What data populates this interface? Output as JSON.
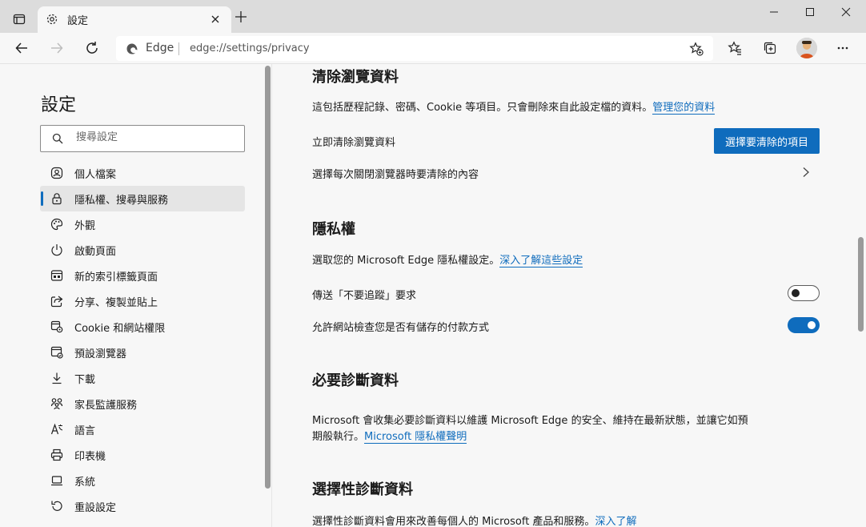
{
  "window": {
    "tab_title": "設定"
  },
  "toolbar": {
    "address_prefix": "Edge",
    "url": "edge://settings/privacy"
  },
  "sidebar": {
    "title": "設定",
    "search_placeholder": "搜尋設定",
    "items": [
      {
        "label": "個人檔案",
        "icon": "profile-icon"
      },
      {
        "label": "隱私權、搜尋與服務",
        "icon": "lock-icon",
        "active": true
      },
      {
        "label": "外觀",
        "icon": "palette-icon"
      },
      {
        "label": "啟動頁面",
        "icon": "power-icon"
      },
      {
        "label": "新的索引標籤頁面",
        "icon": "newtab-icon"
      },
      {
        "label": "分享、複製並貼上",
        "icon": "share-icon"
      },
      {
        "label": "Cookie 和網站權限",
        "icon": "site-permissions-icon"
      },
      {
        "label": "預設瀏覽器",
        "icon": "default-browser-icon"
      },
      {
        "label": "下載",
        "icon": "download-icon"
      },
      {
        "label": "家長監護服務",
        "icon": "family-icon"
      },
      {
        "label": "語言",
        "icon": "language-icon"
      },
      {
        "label": "印表機",
        "icon": "printer-icon"
      },
      {
        "label": "系統",
        "icon": "system-icon"
      },
      {
        "label": "重設設定",
        "icon": "reset-icon"
      }
    ]
  },
  "content": {
    "clear_data": {
      "heading": "清除瀏覽資料",
      "desc": "這包括歷程記錄、密碼、Cookie 等項目。只會刪除來自此設定檔的資料。",
      "desc_link": "管理您的資料",
      "clear_now_label": "立即清除瀏覽資料",
      "clear_button": "選擇要清除的項目",
      "on_close_label": "選擇每次關閉瀏覽器時要清除的內容"
    },
    "privacy": {
      "heading": "隱私權",
      "desc": "選取您的 Microsoft Edge 隱私權設定。",
      "desc_link": "深入了解這些設定",
      "dnt_label": "傳送「不要追蹤」要求",
      "dnt_enabled": false,
      "payment_label": "允許網站檢查您是否有儲存的付款方式",
      "payment_enabled": true
    },
    "required_diag": {
      "heading": "必要診斷資料",
      "desc_line1": "Microsoft 會收集必要診斷資料以維護 Microsoft Edge 的安全、維持在最新狀態，並讓它如預",
      "desc_line2": "期般執行。",
      "desc_link": "Microsoft 隱私權聲明"
    },
    "optional_diag": {
      "heading": "選擇性診斷資料",
      "desc": "選擇性診斷資料會用來改善每個人的 Microsoft 產品和服務。",
      "desc_link": "深入了解"
    }
  },
  "colors": {
    "accent": "#0f6cbd",
    "background": "#f7f7f7",
    "titlebar": "#dcdcdc"
  }
}
